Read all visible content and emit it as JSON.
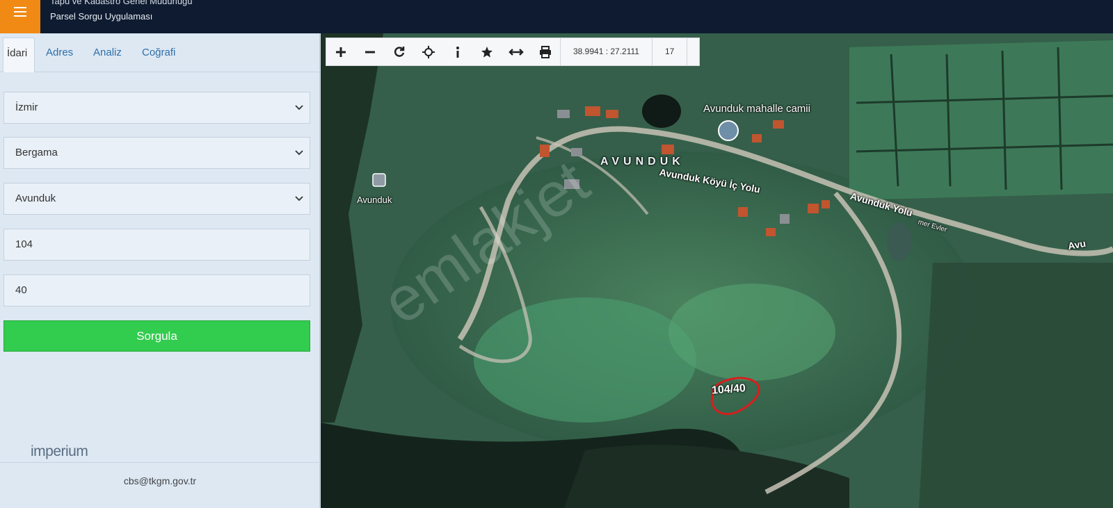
{
  "header": {
    "title_line1": "Tapu ve Kadastro Genel Müdürlüğü",
    "title_line2": "Parsel Sorgu Uygulaması"
  },
  "tabs": [
    {
      "label": "İdari",
      "active": true
    },
    {
      "label": "Adres",
      "active": false
    },
    {
      "label": "Analiz",
      "active": false
    },
    {
      "label": "Coğrafi",
      "active": false
    }
  ],
  "form": {
    "province": "İzmir",
    "district": "Bergama",
    "neighborhood": "Avunduk",
    "block": "104",
    "parcel": "40",
    "submit_label": "Sorgula"
  },
  "logo": {
    "text": "imperium"
  },
  "footer": {
    "email": "cbs@tkgm.gov.tr"
  },
  "toolbar": {
    "coordinates": "38.9941 : 27.2111",
    "zoom_level": "17",
    "tools": [
      "zoom-in-icon",
      "zoom-out-icon",
      "refresh-icon",
      "locate-icon",
      "info-icon",
      "favorite-icon",
      "measure-icon",
      "print-icon"
    ]
  },
  "map": {
    "village_label": "AVUNDUK",
    "mosque_label": "Avunduk mahalle camii",
    "poi_label": "Avunduk",
    "road_label_1": "Avunduk Köyü İç Yolu",
    "road_label_2": "Avunduk Yolu",
    "road_label_3": "mer Evler",
    "road_label_4": "Avu",
    "parcel_label": "104/40",
    "watermark": "emlakjet"
  },
  "colors": {
    "header_bg": "#0e1b30",
    "menu_button": "#f08a14",
    "submit_button": "#32cc4e",
    "parcel_outline": "#d81e1e"
  }
}
